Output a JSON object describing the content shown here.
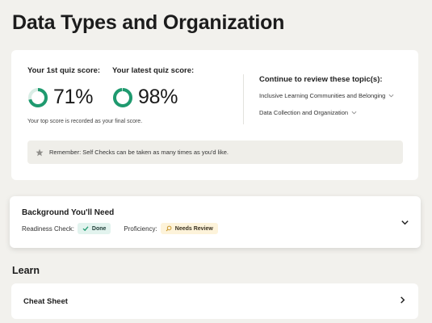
{
  "page": {
    "title": "Data Types and Organization"
  },
  "scores": {
    "first_label": "Your 1st quiz score:",
    "first_value": "71%",
    "first_fraction": 0.71,
    "latest_label": "Your latest quiz score:",
    "latest_value": "98%",
    "latest_fraction": 0.98,
    "note": "Your top score is recorded as your final score.",
    "ring_color": "#1f9a6f",
    "ring_track_color": "#d9ede5"
  },
  "review": {
    "title": "Continue to review these topic(s):",
    "topics": [
      {
        "label": "Inclusive Learning Communities and Belonging",
        "icon": "chevron-down-icon"
      },
      {
        "label": "Data Collection and Organization",
        "icon": "chevron-down-icon"
      }
    ]
  },
  "reminder": {
    "icon": "star-icon",
    "text": "Remember: Self Checks can be taken as many times as you'd like."
  },
  "background": {
    "title": "Background You'll Need",
    "readiness_label": "Readiness Check:",
    "readiness_badge": "Done",
    "proficiency_label": "Proficiency:",
    "proficiency_badge": "Needs Review",
    "icon": "chevron-down-icon"
  },
  "learn": {
    "title": "Learn",
    "items": [
      {
        "label": "Cheat Sheet",
        "icon": "chevron-right-icon"
      }
    ]
  }
}
